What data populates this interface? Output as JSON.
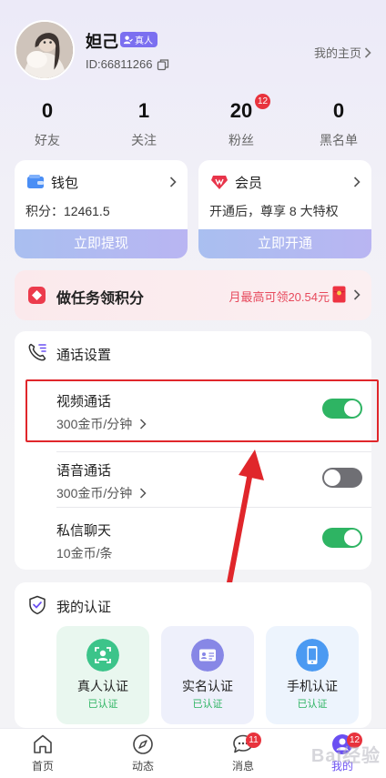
{
  "profile": {
    "nickname": "妲己",
    "real_badge": "真人",
    "uid": "ID:66811266",
    "homepage_link": "我的主页"
  },
  "stats": [
    {
      "value": "0",
      "label": "好友"
    },
    {
      "value": "1",
      "label": "关注"
    },
    {
      "value": "20",
      "label": "粉丝",
      "badge": "12"
    },
    {
      "value": "0",
      "label": "黑名单"
    }
  ],
  "wallet": {
    "title": "钱包",
    "points": "积分：12461.5",
    "action": "立即提现"
  },
  "vip": {
    "title": "会员",
    "desc": "开通后，尊享 8 大特权",
    "action": "立即开通"
  },
  "task": {
    "title": "做任务领积分",
    "subtitle": "月最高可领20.54元"
  },
  "call_settings": {
    "title": "通话设置",
    "rows": [
      {
        "name": "视频通话",
        "price": "300金币/分钟",
        "enabled": true
      },
      {
        "name": "语音通话",
        "price": "300金币/分钟",
        "enabled": false
      },
      {
        "name": "私信聊天",
        "price": "10金币/条",
        "enabled": true
      }
    ]
  },
  "verification": {
    "title": "我的认证",
    "items": [
      {
        "label": "真人认证",
        "status": "已认证"
      },
      {
        "label": "实名认证",
        "status": "已认证"
      },
      {
        "label": "手机认证",
        "status": "已认证"
      }
    ]
  },
  "tabbar": {
    "tabs": [
      {
        "label": "首页"
      },
      {
        "label": "动态"
      },
      {
        "label": "消息",
        "badge": "11"
      },
      {
        "label": "我的",
        "badge": "12"
      }
    ]
  },
  "watermark": "Bai经验",
  "colors": {
    "accent": "#6a4ff2",
    "toggle_on": "#2eb463",
    "toggle_off": "#6f6f74",
    "badge_red": "#e8333d",
    "annotation_red": "#e0262b"
  }
}
